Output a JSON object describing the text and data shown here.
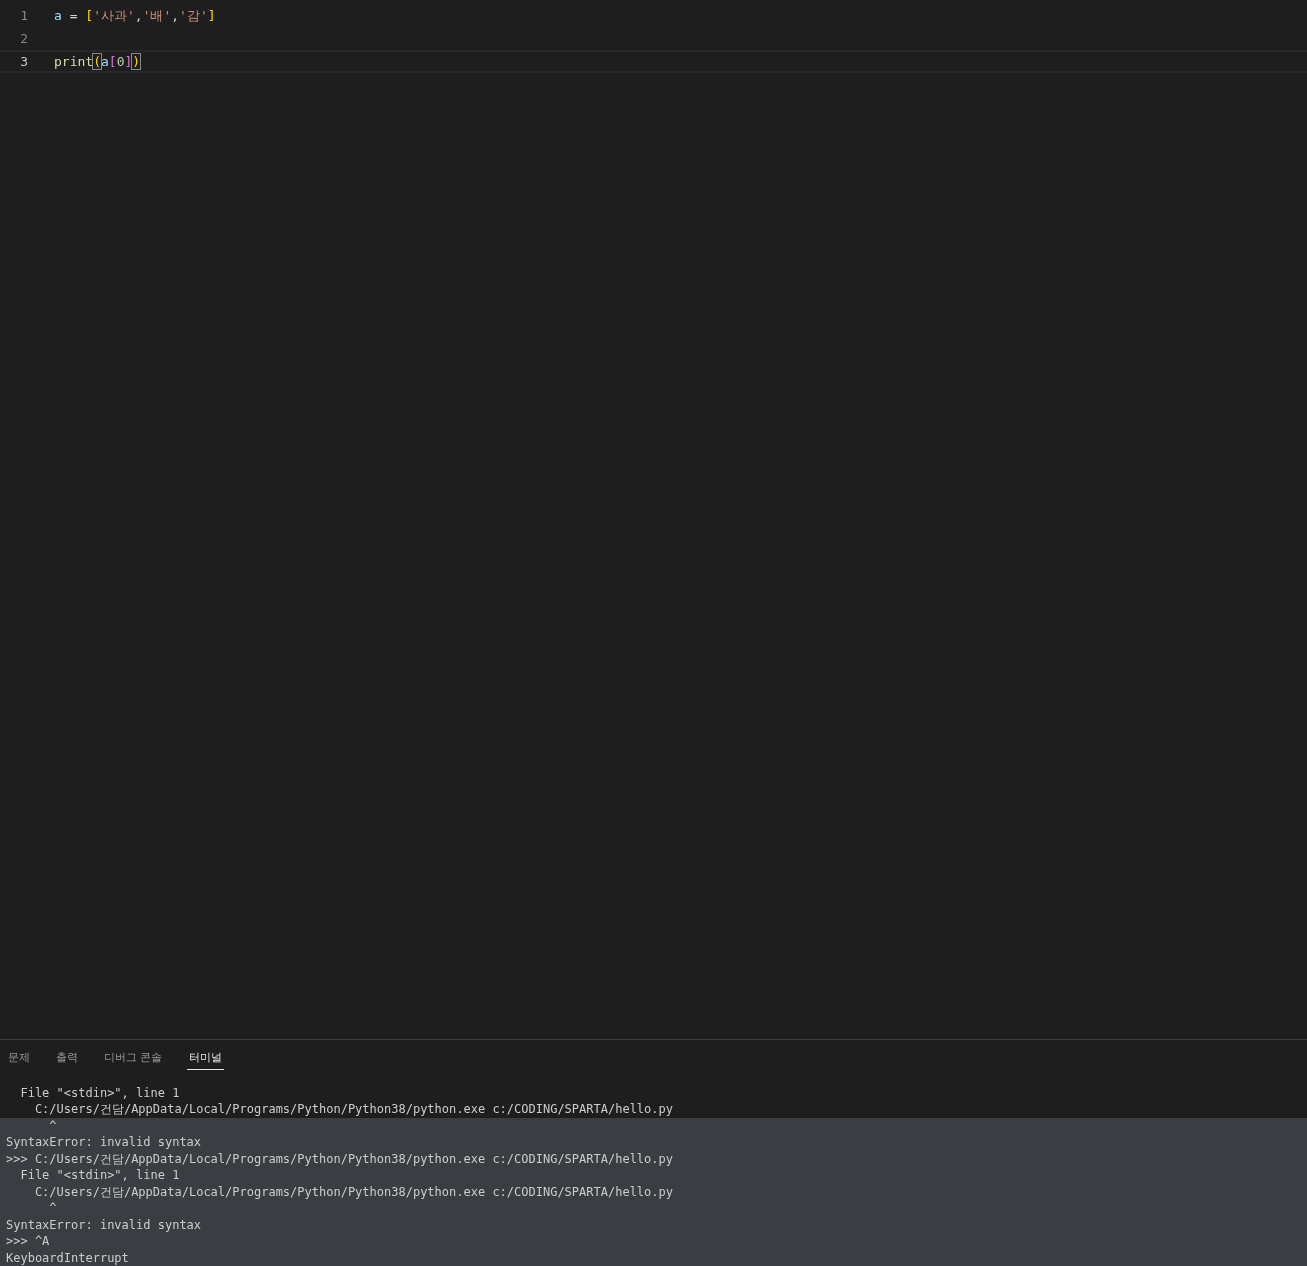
{
  "editor": {
    "lines": [
      {
        "number": "1",
        "active": false,
        "tokens": [
          {
            "text": "a",
            "kind": "variable",
            "matched": false
          },
          {
            "text": " = ",
            "kind": "operator",
            "matched": false
          },
          {
            "text": "[",
            "kind": "bracket",
            "matched": false
          },
          {
            "text": "'사과'",
            "kind": "string",
            "matched": false
          },
          {
            "text": ",",
            "kind": "operator",
            "matched": false
          },
          {
            "text": "'배'",
            "kind": "string",
            "matched": false
          },
          {
            "text": ",",
            "kind": "operator",
            "matched": false
          },
          {
            "text": "'감'",
            "kind": "string",
            "matched": false
          },
          {
            "text": "]",
            "kind": "bracket",
            "matched": false
          }
        ]
      },
      {
        "number": "2",
        "active": false
      },
      {
        "number": "3",
        "active": true,
        "tokens": [
          {
            "text": "print",
            "kind": "function",
            "matched": false
          },
          {
            "text": "(",
            "kind": "bracket",
            "matched": true
          },
          {
            "text": "a",
            "kind": "variable",
            "matched": false
          },
          {
            "text": "[",
            "kind": "bracket2",
            "matched": false
          },
          {
            "text": "0",
            "kind": "number",
            "matched": false
          },
          {
            "text": "]",
            "kind": "bracket2",
            "matched": false
          },
          {
            "text": ")",
            "kind": "bracket",
            "matched": true
          }
        ]
      }
    ]
  },
  "panel": {
    "tabs": [
      {
        "label": "문제",
        "selected": false
      },
      {
        "label": "출력",
        "selected": false
      },
      {
        "label": "디버그 콘솔",
        "selected": false
      },
      {
        "label": "터미널",
        "selected": true
      }
    ],
    "terminal": [
      {
        "text": "  File \"<stdin>\", line 1",
        "selected": false
      },
      {
        "text": "    C:/Users/건담/AppData/Local/Programs/Python/Python38/python.exe c:/CODING/SPARTA/hello.py",
        "selected": false
      },
      {
        "text": "      ^",
        "selected": true
      },
      {
        "text": "SyntaxError: invalid syntax",
        "selected": true
      },
      {
        "text": ">>> C:/Users/건담/AppData/Local/Programs/Python/Python38/python.exe c:/CODING/SPARTA/hello.py",
        "selected": true
      },
      {
        "text": "  File \"<stdin>\", line 1",
        "selected": true
      },
      {
        "text": "    C:/Users/건담/AppData/Local/Programs/Python/Python38/python.exe c:/CODING/SPARTA/hello.py",
        "selected": true
      },
      {
        "text": "      ^",
        "selected": true
      },
      {
        "text": "SyntaxError: invalid syntax",
        "selected": true
      },
      {
        "text": ">>> ^A",
        "selected": true
      },
      {
        "text": "KeyboardInterrupt",
        "selected": true
      }
    ]
  }
}
